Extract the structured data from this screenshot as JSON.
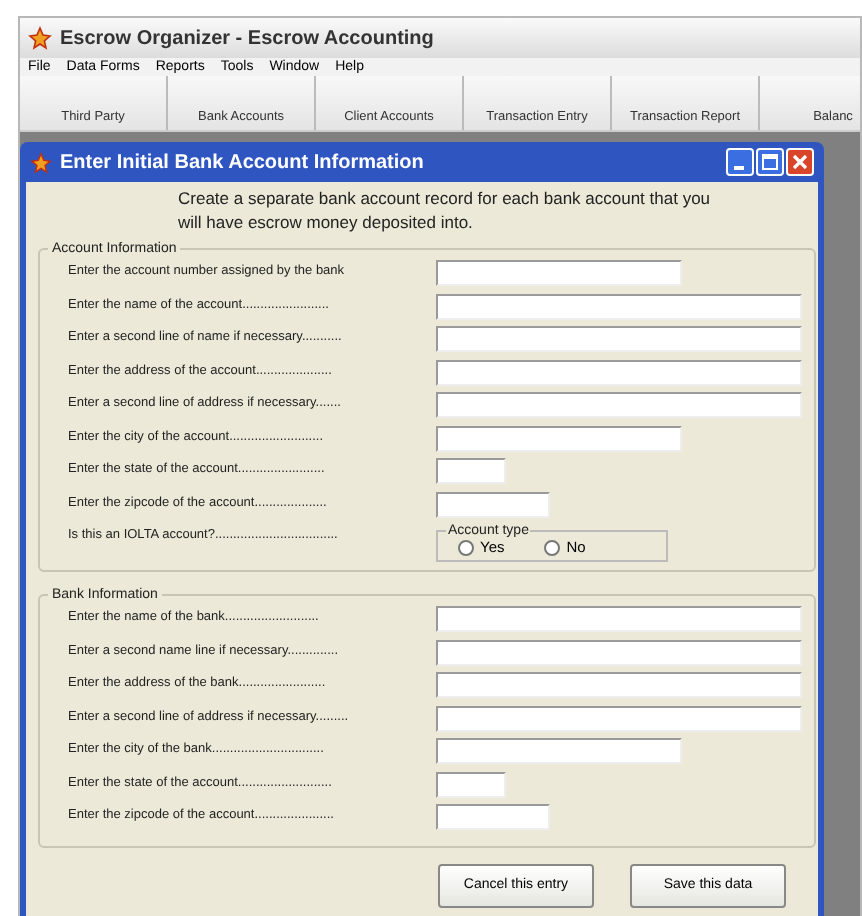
{
  "window": {
    "title": "Escrow Organizer - Escrow Accounting"
  },
  "menu": [
    "File",
    "Data Forms",
    "Reports",
    "Tools",
    "Window",
    "Help"
  ],
  "toolbar": [
    "Third Party",
    "Bank Accounts",
    "Client Accounts",
    "Transaction Entry",
    "Transaction Report",
    "Balanc"
  ],
  "dialog": {
    "title": "Enter Initial Bank Account Information",
    "intro": "Create a separate bank account record for each bank account that you will have escrow money deposited into.",
    "sections": [
      {
        "title": "Account Information",
        "rows": [
          {
            "kind": "medium",
            "label": "Enter the account number assigned by the bank"
          },
          {
            "kind": "wide",
            "label": "Enter the name of the account........................"
          },
          {
            "kind": "wide",
            "label": "Enter a second line of name if necessary..........."
          },
          {
            "kind": "wide",
            "label": "Enter the address of the account....................."
          },
          {
            "kind": "wide",
            "label": "Enter a second line of address if necessary......."
          },
          {
            "kind": "medium",
            "label": "Enter the city of the account.........................."
          },
          {
            "kind": "tiny",
            "label": "Enter the state of the account........................"
          },
          {
            "kind": "short",
            "label": "Enter the zipcode of the account...................."
          },
          {
            "kind": "radio",
            "label": "Is this an IOLTA account?..................................",
            "group": "Account type",
            "options": [
              {
                "label": "Yes",
                "selected": false
              },
              {
                "label": "No",
                "selected": false
              }
            ]
          }
        ]
      },
      {
        "title": "Bank Information",
        "rows": [
          {
            "kind": "wide",
            "label": "Enter the name of the bank.........................."
          },
          {
            "kind": "wide",
            "label": "Enter a second name line if necessary.............."
          },
          {
            "kind": "wide",
            "label": "Enter the address of the bank........................"
          },
          {
            "kind": "wide",
            "label": "Enter a second line of address if necessary........."
          },
          {
            "kind": "medium",
            "label": "Enter the city of the bank..............................."
          },
          {
            "kind": "tiny",
            "label": "Enter the state of the account.........................."
          },
          {
            "kind": "short",
            "label": "Enter the zipcode of the account......................"
          }
        ]
      }
    ],
    "buttons": [
      "Cancel this entry",
      "Save this data"
    ]
  }
}
